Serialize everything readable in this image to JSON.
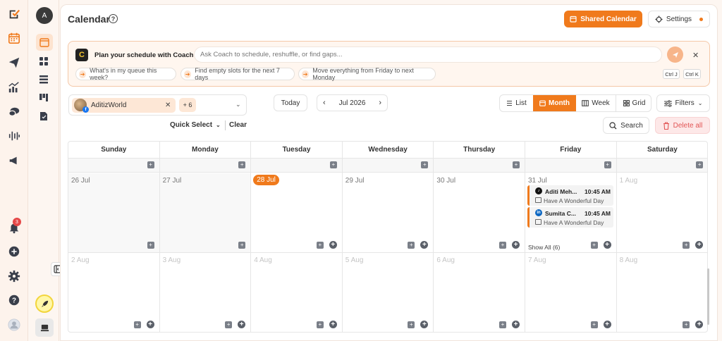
{
  "header": {
    "title": "Calendar",
    "shared_calendar": "Shared Calendar",
    "settings": "Settings",
    "avatar_letter": "A"
  },
  "coach": {
    "logo_letter": "C",
    "title": "Plan your schedule with Coach",
    "placeholder": "Ask Coach to schedule, reshuffle, or find gaps...",
    "suggestions": [
      "What's in my queue this week?",
      "Find empty slots for the next 7 days",
      "Move everything from Friday to next Monday"
    ],
    "shortcuts": [
      "Ctrl J",
      "Ctrl K"
    ]
  },
  "filters": {
    "account": "AditizWorld",
    "more_count": "+ 6",
    "quick_select": "Quick Select",
    "clear": "Clear",
    "today": "Today",
    "month_label": "Jul 2026",
    "views": [
      "List",
      "Month",
      "Week",
      "Grid"
    ],
    "active_view": "Month",
    "filters": "Filters",
    "search": "Search",
    "delete_all": "Delete all"
  },
  "calendar": {
    "days": [
      "Sunday",
      "Monday",
      "Tuesday",
      "Wednesday",
      "Thursday",
      "Friday",
      "Saturday"
    ],
    "week1": [
      "26 Jul",
      "27 Jul",
      "28 Jul",
      "29 Jul",
      "30 Jul",
      "31 Jul",
      "1 Aug"
    ],
    "week2": [
      "2 Aug",
      "3 Aug",
      "4 Aug",
      "5 Aug",
      "6 Aug",
      "7 Aug",
      "8 Aug"
    ],
    "today": "28 Jul",
    "events": [
      {
        "name": "Aditi Meh...",
        "time": "10:45 AM",
        "desc": "Have A Wonderful Day",
        "network": "tiktok"
      },
      {
        "name": "Sumita C...",
        "time": "10:45 AM",
        "desc": "Have A Wonderful Day",
        "network": "linkedin"
      }
    ],
    "show_all": "Show All (6)"
  },
  "sidebar": {
    "notification_count": "3"
  },
  "colors": {
    "accent": "#f07a1c",
    "danger": "#e25555"
  }
}
